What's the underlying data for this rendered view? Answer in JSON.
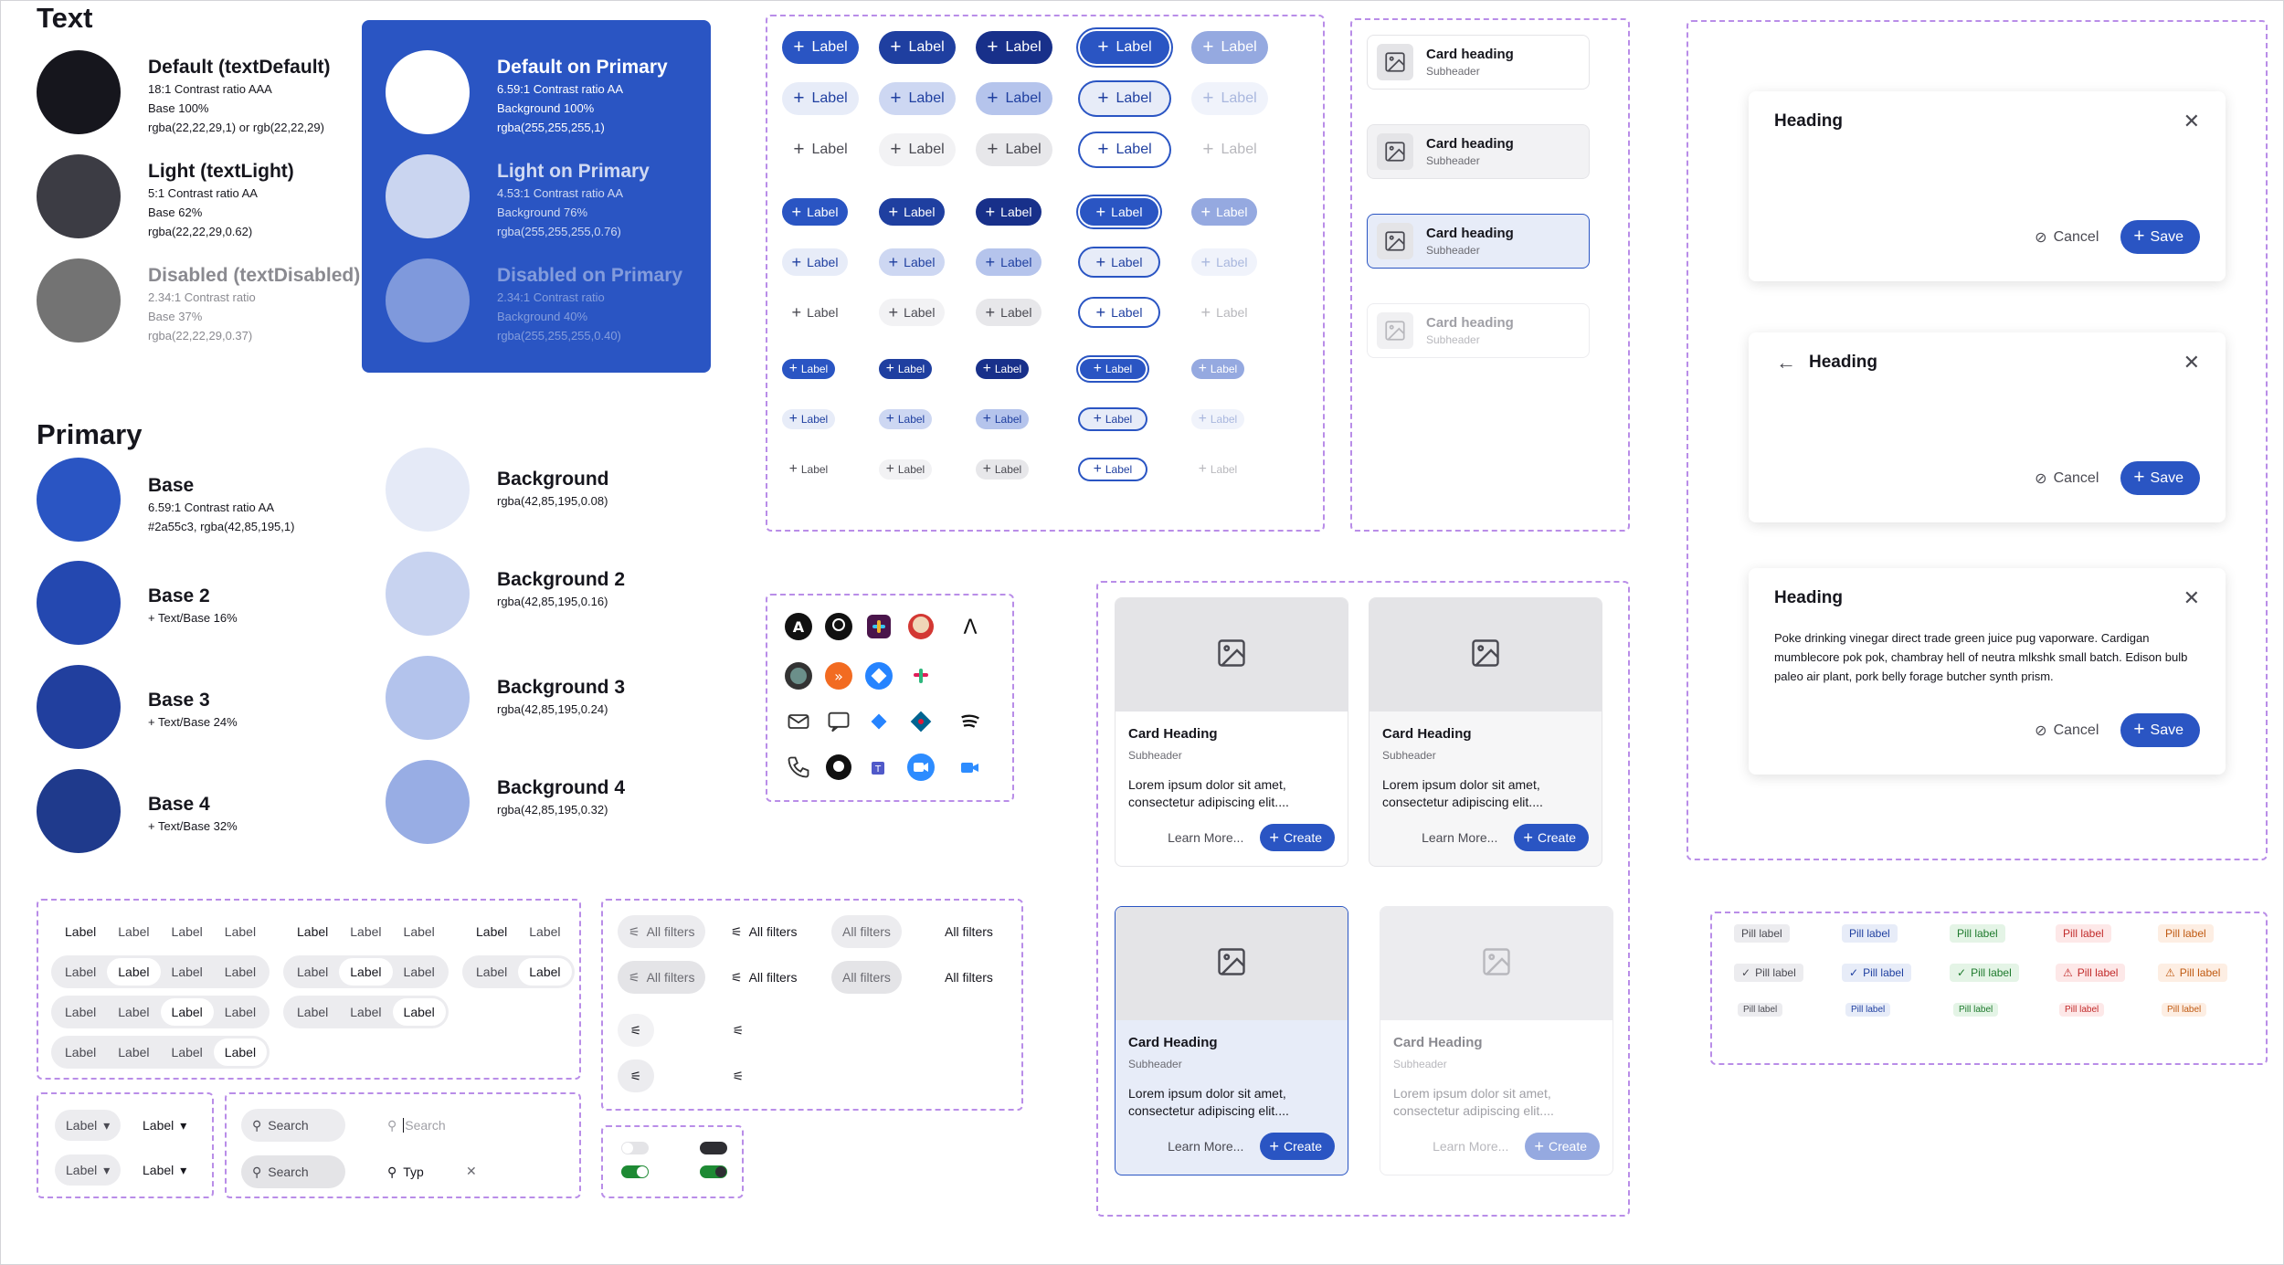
{
  "colors": {
    "primary": "#2a55c3",
    "base2": "#2448b0",
    "base3": "#213f9e",
    "base4": "#1f3a8c",
    "text_default": "#16161d",
    "text_light": "#3c3c44",
    "text_disabled": "#737373",
    "bg1": "#e5eaf7",
    "bg2": "#c8d3f0",
    "bg3": "#b3c3ec",
    "bg4": "#98ade4"
  },
  "text_section": {
    "title": "Text",
    "items": [
      {
        "name": "Default (textDefault)",
        "l1": "18:1 Contrast ratio AAA",
        "l2": "Base 100%",
        "l3": "rgba(22,22,29,1) or rgb(22,22,29)"
      },
      {
        "name": "Light (textLight)",
        "l1": "5:1 Contrast ratio AA",
        "l2": "Base 62%",
        "l3": "rgba(22,22,29,0.62)"
      },
      {
        "name": "Disabled (textDisabled)",
        "l1": "2.34:1 Contrast ratio",
        "l2": "Base 37%",
        "l3": "rgba(22,22,29,0.37)"
      }
    ]
  },
  "on_primary": [
    {
      "name": "Default on Primary",
      "l1": "6.59:1 Contrast ratio AA",
      "l2": "Background 100%",
      "l3": "rgba(255,255,255,1)"
    },
    {
      "name": "Light on Primary",
      "l1": "4.53:1 Contrast ratio AA",
      "l2": "Background 76%",
      "l3": "rgba(255,255,255,0.76)"
    },
    {
      "name": "Disabled on Primary",
      "l1": "2.34:1 Contrast ratio",
      "l2": "Background 40%",
      "l3": "rgba(255,255,255,0.40)"
    }
  ],
  "primary_section": {
    "title": "Primary",
    "bases": [
      {
        "name": "Base",
        "l1": "6.59:1 Contrast ratio AA",
        "l2": "#2a55c3, rgba(42,85,195,1)"
      },
      {
        "name": "Base 2",
        "l1": "+ Text/Base 16%"
      },
      {
        "name": "Base 3",
        "l1": "+ Text/Base 24%"
      },
      {
        "name": "Base 4",
        "l1": "+ Text/Base 32%"
      }
    ],
    "backgrounds": [
      {
        "name": "Background",
        "l1": "rgba(42,85,195,0.08)"
      },
      {
        "name": "Background 2",
        "l1": "rgba(42,85,195,0.16)"
      },
      {
        "name": "Background 3",
        "l1": "rgba(42,85,195,0.24)"
      },
      {
        "name": "Background 4",
        "l1": "rgba(42,85,195,0.32)"
      }
    ]
  },
  "button_label": "Label",
  "mini_card": {
    "heading": "Card heading",
    "sub": "Subheader"
  },
  "big_card": {
    "heading": "Card Heading",
    "sub": "Subheader",
    "body": "Lorem ipsum dolor sit amet, consectetur adipiscing elit....",
    "learn": "Learn More...",
    "create": "Create"
  },
  "dialogs": [
    {
      "heading": "Heading",
      "body": ""
    },
    {
      "heading": "Heading",
      "body": ""
    },
    {
      "heading": "Heading",
      "body": "Poke drinking vinegar direct trade green juice pug vaporware. Cardigan mumblecore pok pok, chambray hell of neutra mlkshk small batch. Edison bulb paleo air plant, pork belly forage butcher synth prism."
    }
  ],
  "dialog_cancel": "Cancel",
  "dialog_save": "Save",
  "seg_label": "Label",
  "filters": "All filters",
  "dropdown_label": "Label",
  "search": {
    "placeholder": "Search",
    "typed": "Typ"
  },
  "pill": "Pill label"
}
